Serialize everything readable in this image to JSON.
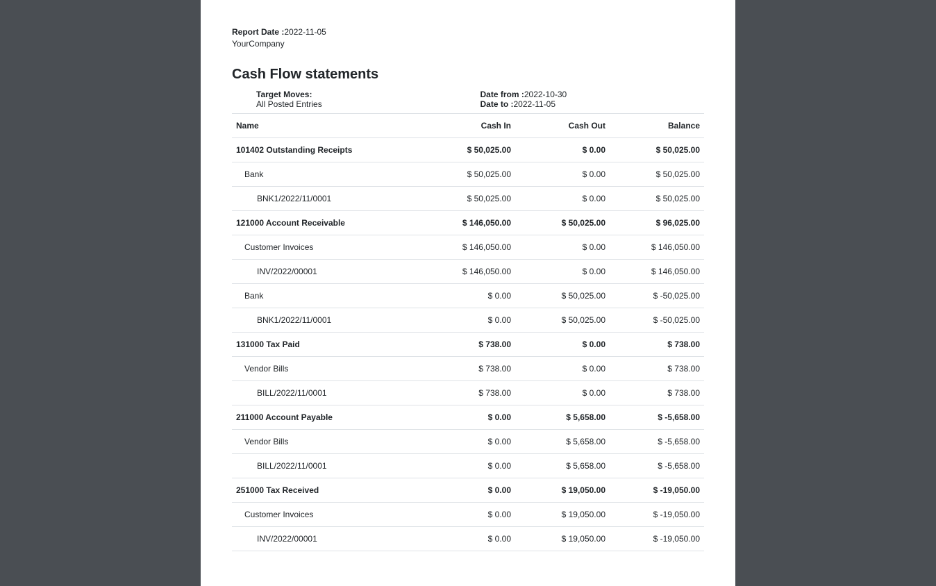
{
  "meta": {
    "report_date_label": "Report Date :",
    "report_date_value": "2022-11-05",
    "company": "YourCompany"
  },
  "title": "Cash Flow statements",
  "params": {
    "target_moves_label": "Target Moves:",
    "target_moves_value": "All Posted Entries",
    "date_from_label": "Date from :",
    "date_from_value": "2022-10-30",
    "date_to_label": "Date to :",
    "date_to_value": "2022-11-05"
  },
  "columns": {
    "name": "Name",
    "cash_in": "Cash In",
    "cash_out": "Cash Out",
    "balance": "Balance"
  },
  "rows": [
    {
      "level": 0,
      "name": "101402 Outstanding Receipts",
      "cash_in": "$ 50,025.00",
      "cash_out": "$ 0.00",
      "balance": "$ 50,025.00"
    },
    {
      "level": 1,
      "name": "Bank",
      "cash_in": "$ 50,025.00",
      "cash_out": "$ 0.00",
      "balance": "$ 50,025.00"
    },
    {
      "level": 2,
      "name": "BNK1/2022/11/0001",
      "cash_in": "$ 50,025.00",
      "cash_out": "$ 0.00",
      "balance": "$ 50,025.00"
    },
    {
      "level": 0,
      "name": "121000 Account Receivable",
      "cash_in": "$ 146,050.00",
      "cash_out": "$ 50,025.00",
      "balance": "$ 96,025.00"
    },
    {
      "level": 1,
      "name": "Customer Invoices",
      "cash_in": "$ 146,050.00",
      "cash_out": "$ 0.00",
      "balance": "$ 146,050.00"
    },
    {
      "level": 2,
      "name": "INV/2022/00001",
      "cash_in": "$ 146,050.00",
      "cash_out": "$ 0.00",
      "balance": "$ 146,050.00"
    },
    {
      "level": 1,
      "name": "Bank",
      "cash_in": "$ 0.00",
      "cash_out": "$ 50,025.00",
      "balance": "$ -50,025.00"
    },
    {
      "level": 2,
      "name": "BNK1/2022/11/0001",
      "cash_in": "$ 0.00",
      "cash_out": "$ 50,025.00",
      "balance": "$ -50,025.00"
    },
    {
      "level": 0,
      "name": "131000 Tax Paid",
      "cash_in": "$ 738.00",
      "cash_out": "$ 0.00",
      "balance": "$ 738.00"
    },
    {
      "level": 1,
      "name": "Vendor Bills",
      "cash_in": "$ 738.00",
      "cash_out": "$ 0.00",
      "balance": "$ 738.00"
    },
    {
      "level": 2,
      "name": "BILL/2022/11/0001",
      "cash_in": "$ 738.00",
      "cash_out": "$ 0.00",
      "balance": "$ 738.00"
    },
    {
      "level": 0,
      "name": "211000 Account Payable",
      "cash_in": "$ 0.00",
      "cash_out": "$ 5,658.00",
      "balance": "$ -5,658.00"
    },
    {
      "level": 1,
      "name": "Vendor Bills",
      "cash_in": "$ 0.00",
      "cash_out": "$ 5,658.00",
      "balance": "$ -5,658.00"
    },
    {
      "level": 2,
      "name": "BILL/2022/11/0001",
      "cash_in": "$ 0.00",
      "cash_out": "$ 5,658.00",
      "balance": "$ -5,658.00"
    },
    {
      "level": 0,
      "name": "251000 Tax Received",
      "cash_in": "$ 0.00",
      "cash_out": "$ 19,050.00",
      "balance": "$ -19,050.00"
    },
    {
      "level": 1,
      "name": "Customer Invoices",
      "cash_in": "$ 0.00",
      "cash_out": "$ 19,050.00",
      "balance": "$ -19,050.00"
    },
    {
      "level": 2,
      "name": "INV/2022/00001",
      "cash_in": "$ 0.00",
      "cash_out": "$ 19,050.00",
      "balance": "$ -19,050.00"
    }
  ]
}
